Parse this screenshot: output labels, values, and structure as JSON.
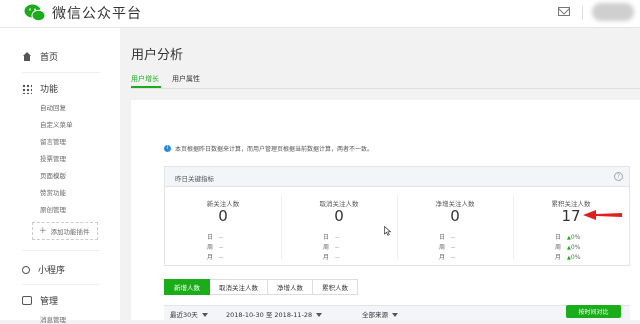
{
  "header": {
    "brand": "微信公众平台",
    "logo_icon": "wechat-logo-icon",
    "mail_icon": "mail-icon"
  },
  "sidebar": {
    "home": "首页",
    "features": "功能",
    "feature_items": [
      "自动回复",
      "自定义菜单",
      "留言管理",
      "投票管理",
      "页面模版",
      "赞赏功能",
      "原创管理"
    ],
    "add_plugin": "添加功能插件",
    "miniprogram": "小程序",
    "manage": "管理",
    "manage_first": "消息管理"
  },
  "main": {
    "title": "用户分析",
    "tabs": [
      {
        "label": "用户增长",
        "active": true
      },
      {
        "label": "用户属性",
        "active": false
      }
    ],
    "notice": "本页根据昨日数据来计算，而用户管理页根据当前数据计算，两者不一致。",
    "kpi_header": "昨日关键指标",
    "kpis": [
      {
        "label": "新关注人数",
        "value": "0",
        "rows": [
          {
            "k": "日",
            "v": "--"
          },
          {
            "k": "周",
            "v": "--"
          },
          {
            "k": "月",
            "v": "--"
          }
        ]
      },
      {
        "label": "取消关注人数",
        "value": "0",
        "rows": [
          {
            "k": "日",
            "v": "--"
          },
          {
            "k": "周",
            "v": "--"
          },
          {
            "k": "月",
            "v": "--"
          }
        ]
      },
      {
        "label": "净增关注人数",
        "value": "0",
        "rows": [
          {
            "k": "日",
            "v": "--"
          },
          {
            "k": "周",
            "v": "--"
          },
          {
            "k": "月",
            "v": "--"
          }
        ]
      },
      {
        "label": "累积关注人数",
        "value": "17",
        "rows": [
          {
            "k": "日",
            "v": "0%"
          },
          {
            "k": "周",
            "v": "0%"
          },
          {
            "k": "月",
            "v": "0%"
          }
        ]
      }
    ],
    "segments": [
      "新增人数",
      "取消关注人数",
      "净增人数",
      "累积人数"
    ],
    "filter": {
      "range": "最近30天",
      "dates": "2018-10-30 至 2018-11-28",
      "source": "全部来源"
    },
    "export": "按时间对比"
  },
  "colors": {
    "accent": "#1aad19",
    "info": "#2a8bd9",
    "annotation": "#e02020"
  }
}
